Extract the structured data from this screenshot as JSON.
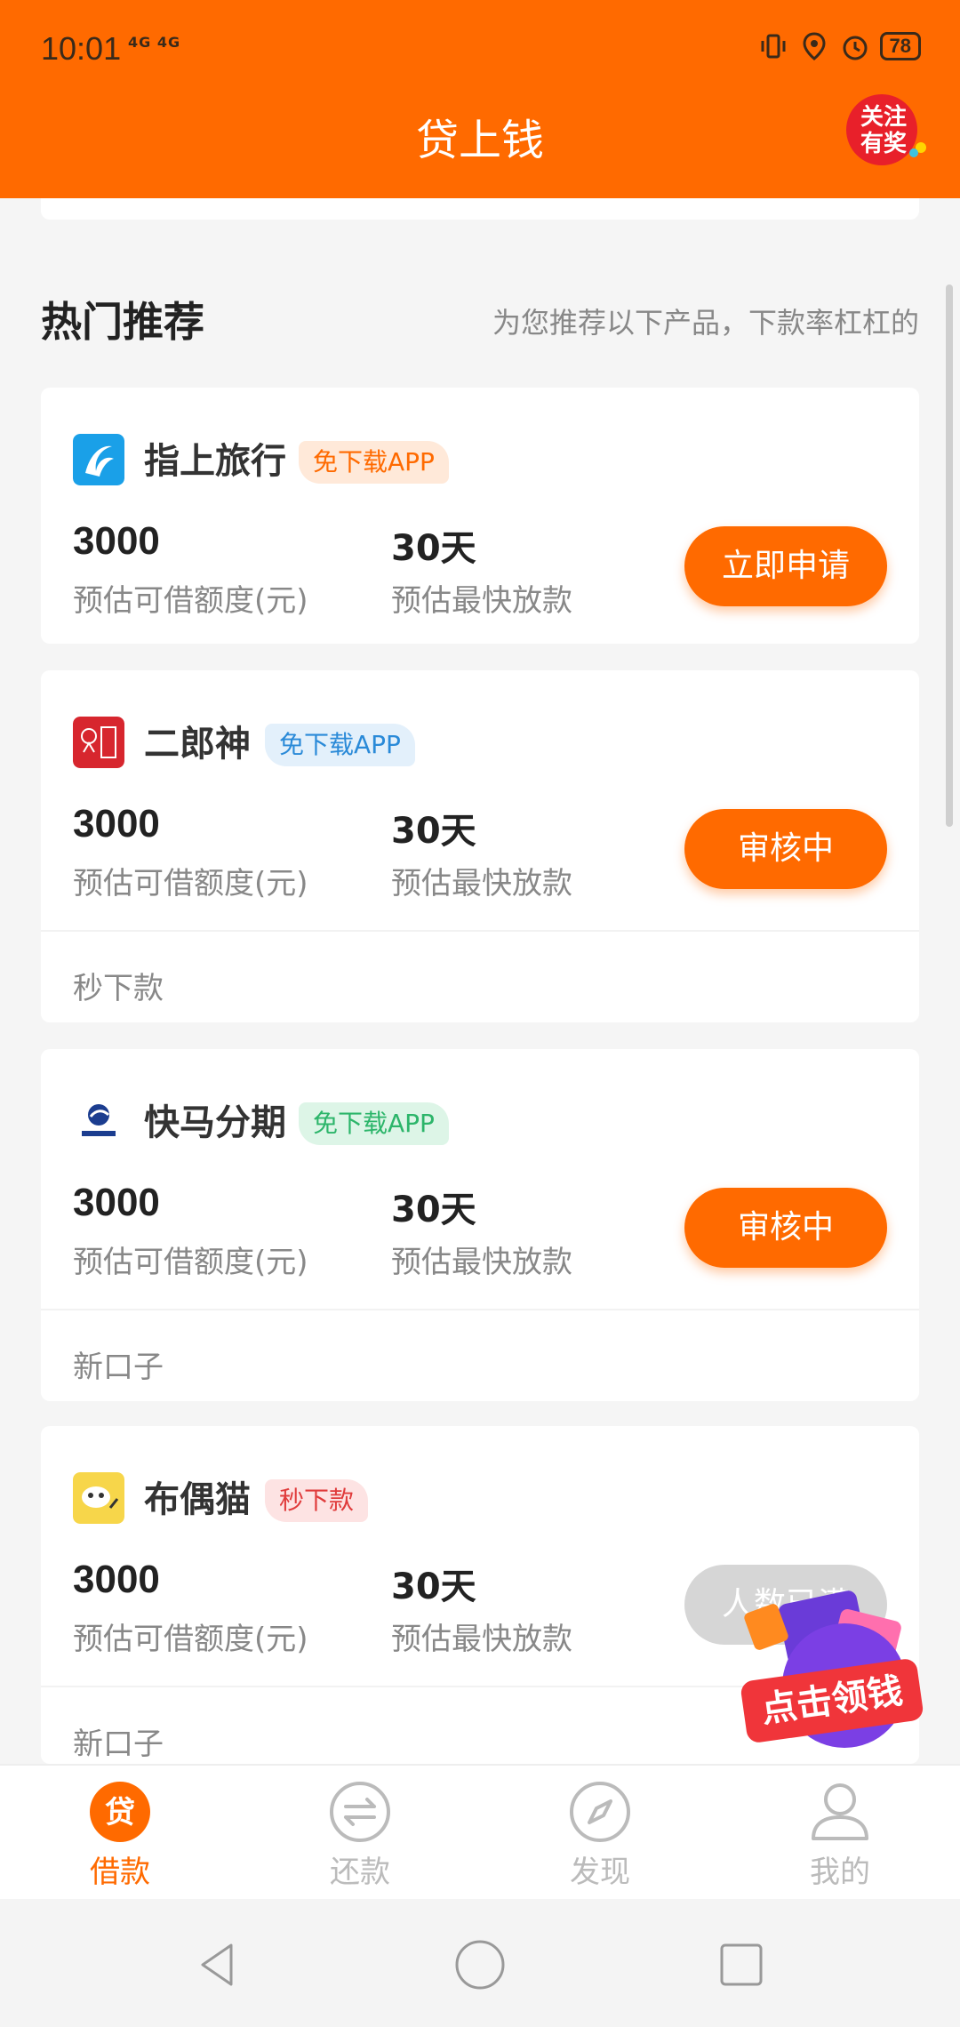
{
  "status_bar": {
    "time": "10:01",
    "network": "4G 4G",
    "battery": "78"
  },
  "header": {
    "title": "贷上钱",
    "follow_badge_text": "关注有奖"
  },
  "section": {
    "title": "热门推荐",
    "subtitle": "为您推荐以下产品，下款率杠杠的"
  },
  "products": [
    {
      "name": "指上旅行",
      "tag": "免下载APP",
      "tag_style": "orange",
      "amount": "3000",
      "amount_label": "预估可借额度(元)",
      "days": "30天",
      "days_label": "预估最快放款",
      "button": "立即申请",
      "button_state": "active",
      "note": ""
    },
    {
      "name": "二郎神",
      "tag": "免下载APP",
      "tag_style": "blue",
      "amount": "3000",
      "amount_label": "预估可借额度(元)",
      "days": "30天",
      "days_label": "预估最快放款",
      "button": "审核中",
      "button_state": "active",
      "note": "秒下款"
    },
    {
      "name": "快马分期",
      "tag": "免下载APP",
      "tag_style": "green",
      "amount": "3000",
      "amount_label": "预估可借额度(元)",
      "days": "30天",
      "days_label": "预估最快放款",
      "button": "审核中",
      "button_state": "active",
      "note": "新口子"
    },
    {
      "name": "布偶猫",
      "tag": "秒下款",
      "tag_style": "red",
      "amount": "3000",
      "amount_label": "预估可借额度(元)",
      "days": "30天",
      "days_label": "预估最快放款",
      "button": "人数已满",
      "button_state": "disabled",
      "note": "新口子"
    }
  ],
  "promo": {
    "text": "点击领钱"
  },
  "bottom_nav": [
    {
      "label": "借款",
      "icon": "loan-icon",
      "icon_char": "贷",
      "active": true
    },
    {
      "label": "还款",
      "icon": "repay-icon",
      "active": false
    },
    {
      "label": "发现",
      "icon": "compass-icon",
      "active": false
    },
    {
      "label": "我的",
      "icon": "profile-icon",
      "active": false
    }
  ],
  "colors": {
    "brand": "#ff6a00",
    "tag_orange_bg": "#ffe9d9",
    "tag_orange_fg": "#ff6a00",
    "tag_blue_bg": "#e3f0fb",
    "tag_blue_fg": "#2a8ad8",
    "tag_green_bg": "#ddf5e7",
    "tag_green_fg": "#2cb56a",
    "tag_red_bg": "#fde3e3",
    "tag_red_fg": "#e03b3b"
  }
}
